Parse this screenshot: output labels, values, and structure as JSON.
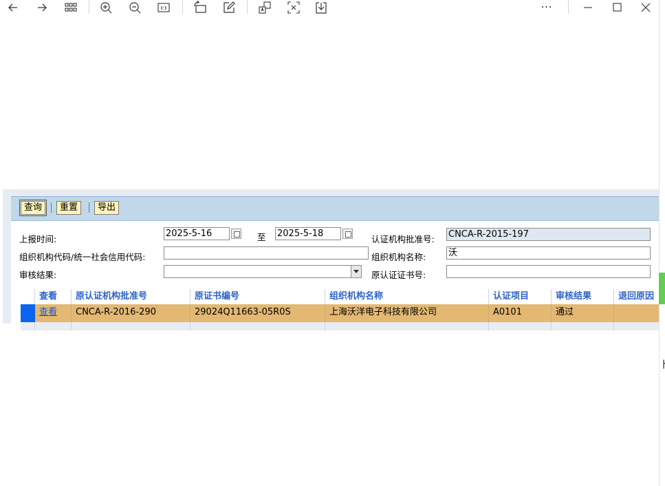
{
  "viewer_toolbar": {
    "icons": [
      "back-arrow-icon",
      "forward-arrow-icon",
      "grid-icon",
      "zoom-in-icon",
      "zoom-out-icon",
      "actual-size-icon",
      "rotate-icon",
      "edit-icon",
      "translate-icon",
      "crop-icon",
      "save-icon",
      "more-icon",
      "minimize-icon",
      "maximize-icon",
      "close-icon"
    ],
    "more_label": "···"
  },
  "form_toolbar": {
    "query_label": "查询",
    "reset_label": "重置",
    "export_label": "导出"
  },
  "form": {
    "report_time_label": "上报时间:",
    "date_from": "2025-5-16",
    "to_label": "至",
    "date_to": "2025-5-18",
    "cert_approval_label": "认证机构批准号:",
    "cert_approval_value": "CNCA-R-2015-197",
    "org_code_label": "组织机构代码/统一社会信用代码:",
    "org_code_value": "",
    "org_name_label": "组织机构名称:",
    "org_name_value": "沃",
    "audit_result_label": "审核结果:",
    "audit_result_value": "",
    "orig_cert_no_label": "原认证证书号:",
    "orig_cert_no_value": ""
  },
  "table": {
    "columns": [
      "查看",
      "原认证机构批准号",
      "原证书编号",
      "组织机构名称",
      "认证项目",
      "审核结果",
      "退回原因"
    ],
    "rows": [
      {
        "view": "查看",
        "orig_approval": "CNCA-R-2016-290",
        "orig_cert": "29024Q11663-05R0S",
        "org_name": "上海沃洋电子科技有限公司",
        "project": "A0101",
        "result": "通过",
        "reason": ""
      }
    ]
  },
  "edge": {
    "glyph": "ト"
  },
  "colors": {
    "toolbar_bg": "#c1d7ea",
    "selected_row": "#e3b873",
    "header_text": "#2d63c8",
    "row_marker": "#0a64f0"
  }
}
